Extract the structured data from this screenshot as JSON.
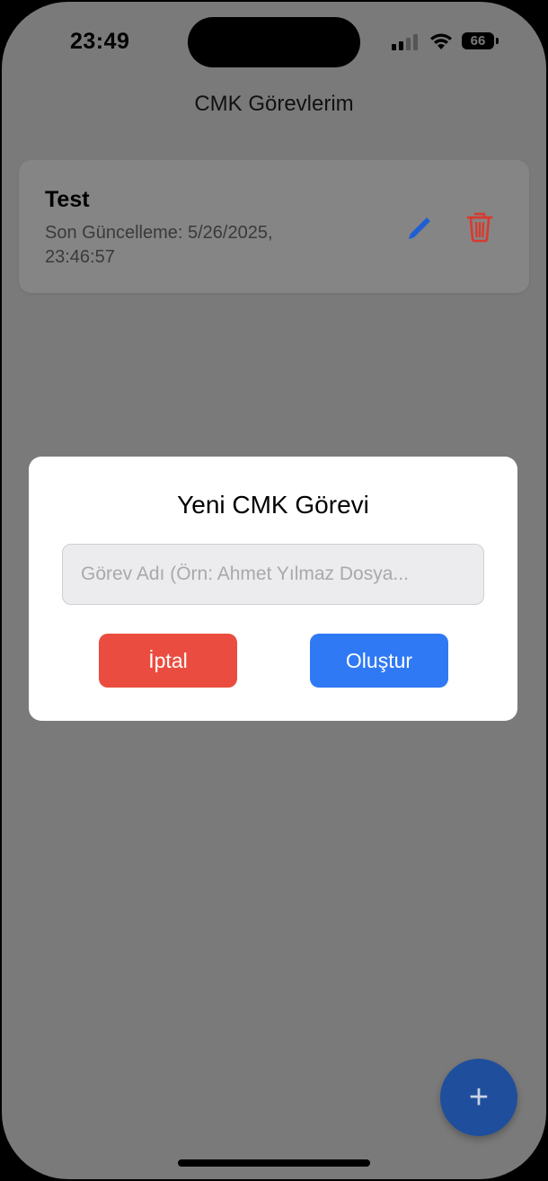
{
  "status_bar": {
    "time": "23:49",
    "battery": "66"
  },
  "header": {
    "title": "CMK Görevlerim"
  },
  "tasks": [
    {
      "title": "Test",
      "updated": "Son Güncelleme: 5/26/2025, 23:46:57",
      "edit_icon": "pencil-icon",
      "delete_icon": "trash-icon"
    }
  ],
  "modal": {
    "title": "Yeni CMK Görevi",
    "input_value": "",
    "input_placeholder": "Görev Adı (Örn: Ahmet Yılmaz Dosya...",
    "cancel_label": "İptal",
    "create_label": "Oluştur"
  },
  "fab": {
    "label": "+"
  },
  "colors": {
    "cancel": "#ea4d3f",
    "create": "#2f79f5",
    "edit_icon": "#1f5fd4",
    "delete_icon": "#d93a2e",
    "fab": "#1f4f9c"
  }
}
